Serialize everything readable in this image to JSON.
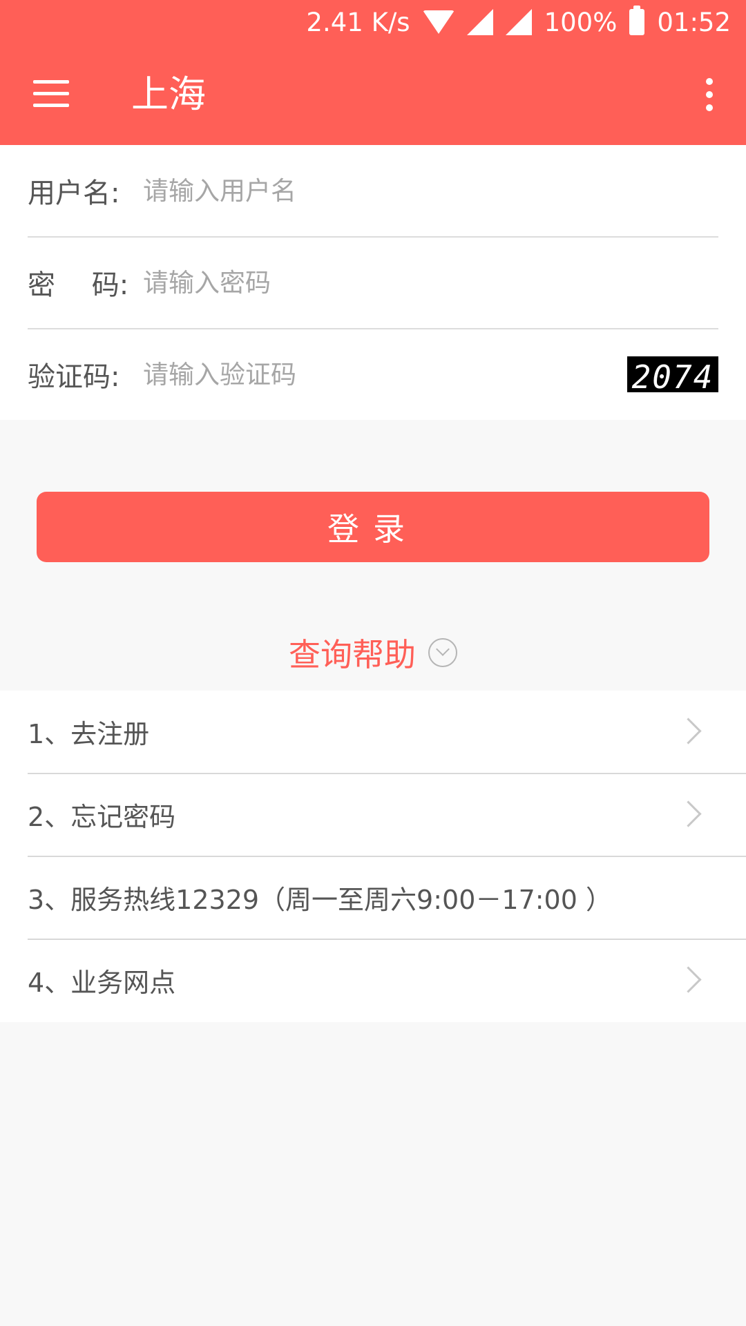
{
  "status_bar": {
    "speed": "2.41 K/s",
    "battery": "100%",
    "time": "01:52"
  },
  "app_bar": {
    "title": "上海"
  },
  "form": {
    "username_label": "用户名:",
    "username_placeholder": "请输入用户名",
    "password_label": "密　 码:",
    "password_placeholder": "请输入密码",
    "captcha_label": "验证码:",
    "captcha_placeholder": "请输入验证码",
    "captcha_text": "2074"
  },
  "login_button": "登录",
  "help": {
    "title": "查询帮助",
    "items": [
      {
        "label": "1、去注册"
      },
      {
        "label": "2、忘记密码"
      },
      {
        "label": "3、服务热线12329（周一至周六9:00－17:00 ）"
      },
      {
        "label": "4、业务网点"
      }
    ]
  },
  "colors": {
    "accent": "#ff5f57",
    "background": "#f8f8f8"
  }
}
